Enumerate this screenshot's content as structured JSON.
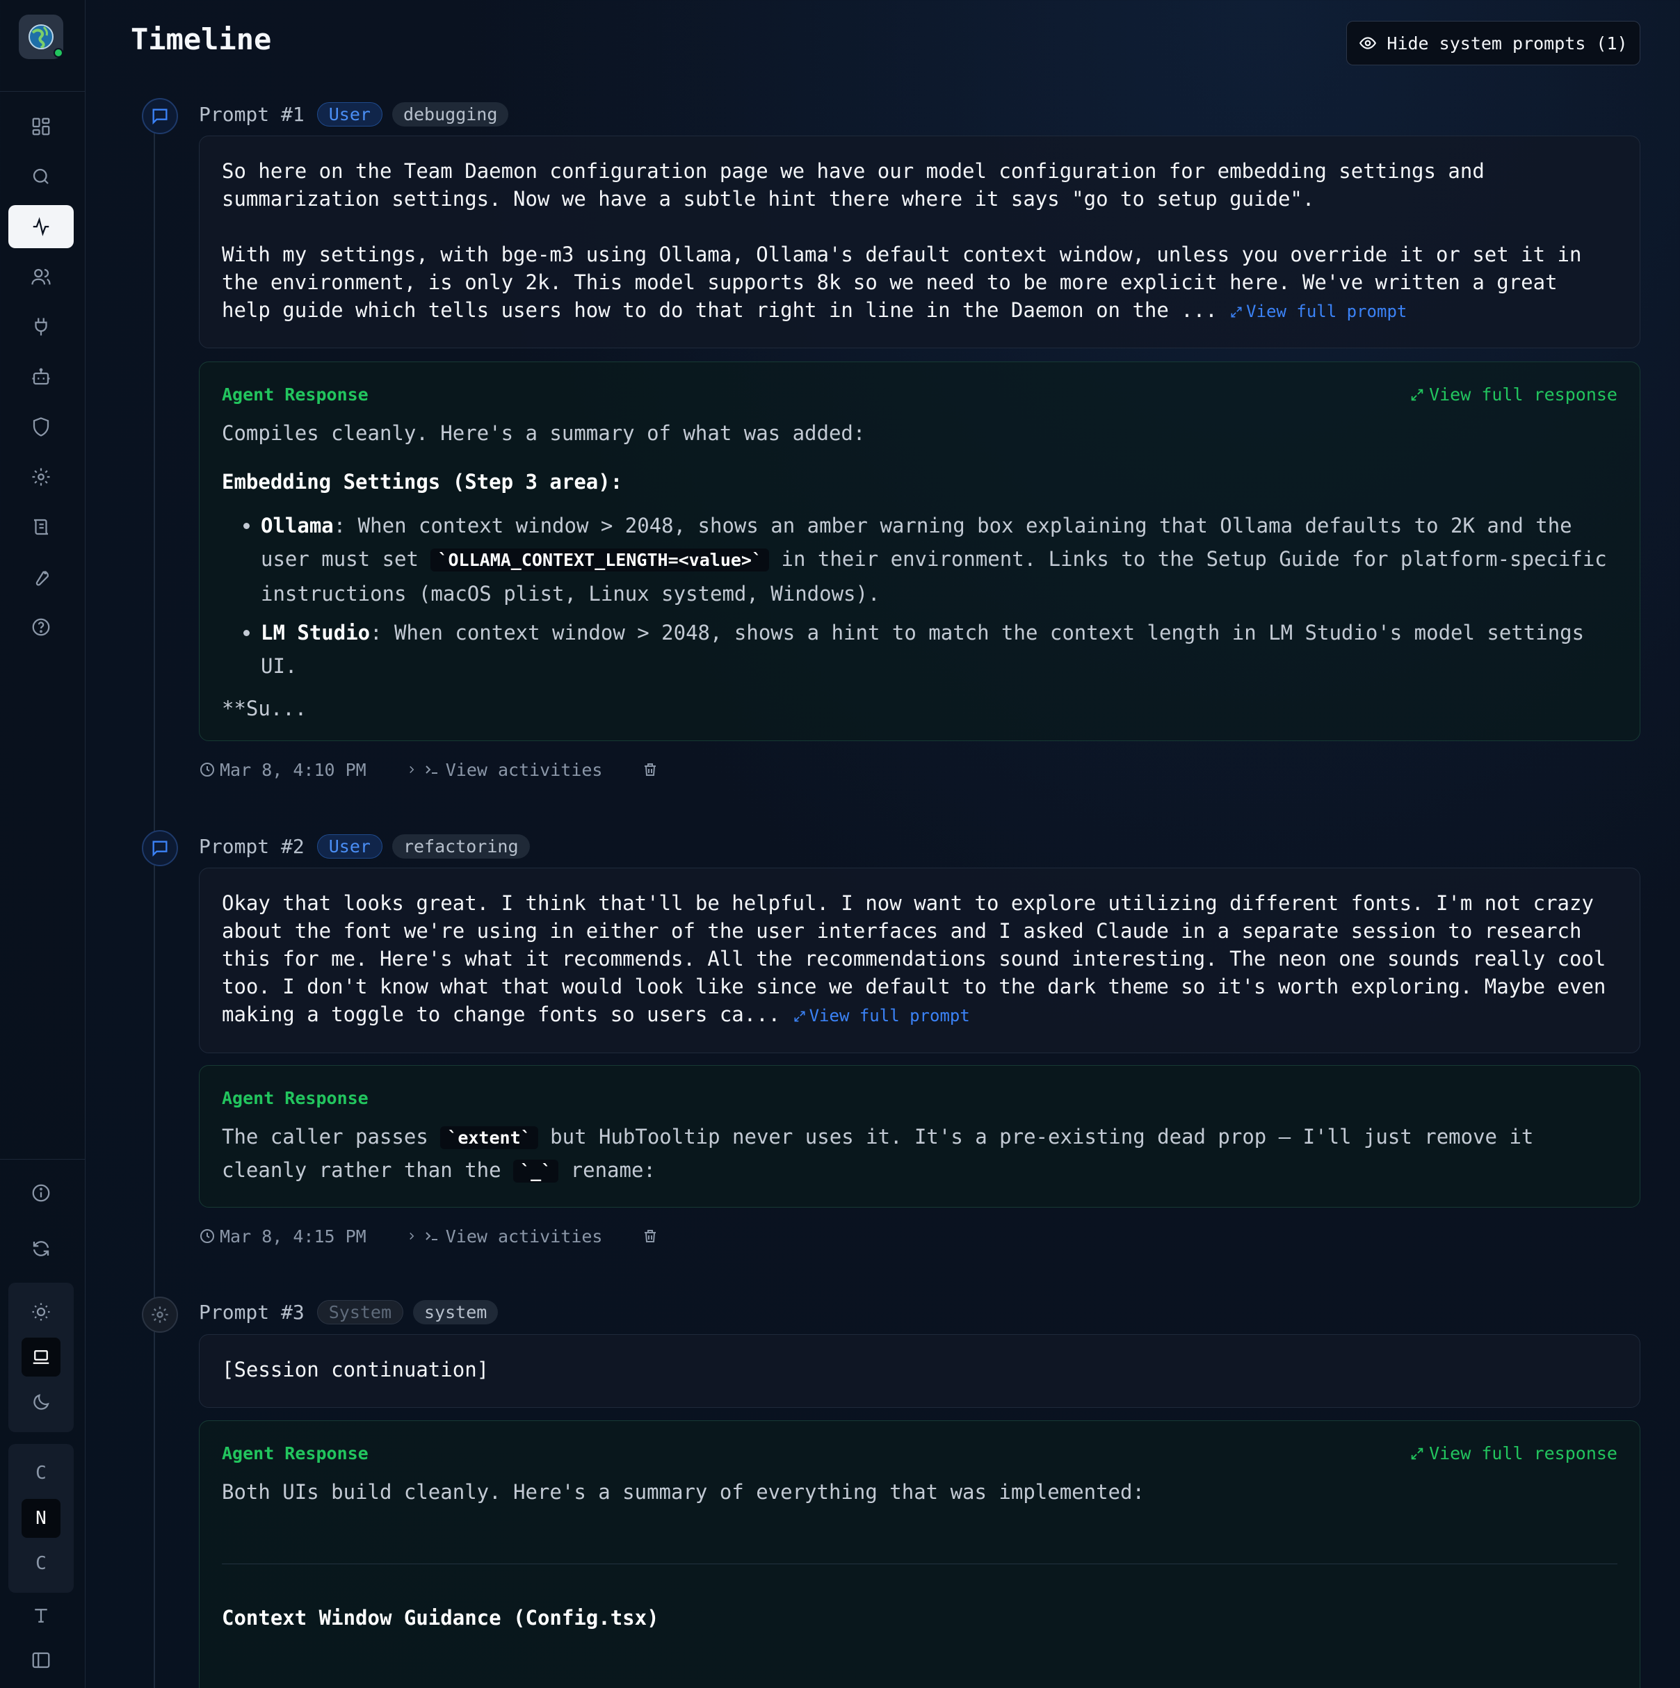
{
  "page": {
    "title": "Timeline",
    "hide_button_label": "Hide system prompts (1)"
  },
  "sidebar": {
    "nav_icons": [
      "dashboard-icon",
      "search-icon",
      "activity-icon",
      "users-icon",
      "plug-icon",
      "bot-icon",
      "shield-icon",
      "gear-icon",
      "logs-icon",
      "wrench-icon",
      "help-icon"
    ],
    "active": "activity-icon",
    "font_options": [
      "C",
      "N",
      "C"
    ]
  },
  "prompts": [
    {
      "number": "Prompt #1",
      "role": "User",
      "tag": "debugging",
      "text_p1": "So here on the Team Daemon configuration page we have our model configuration for embedding settings and summarization settings. Now we have a subtle hint there where it says \"go to setup guide\".",
      "text_p2": "With my settings, with bge-m3 using Ollama, Ollama's default context window, unless you override it or set it in the environment, is only 2k. This model supports 8k so we need to be more explicit here. We've written a great help guide which tells users how to do that right in line in the Daemon on the ...",
      "view_prompt": "View full prompt",
      "response": {
        "label": "Agent Response",
        "view_response": "View full response",
        "intro": "Compiles cleanly. Here's a summary of what was added:",
        "heading": "Embedding Settings (Step 3 area):",
        "item1_name": "Ollama",
        "item1_text_a": ": When context window > 2048, shows an amber warning box explaining that Ollama defaults to 2K and the user must set ",
        "item1_code": "`OLLAMA_CONTEXT_LENGTH=<value>`",
        "item1_text_b": " in their environment. Links to the Setup Guide for platform-specific instructions (macOS plist, Linux systemd, Windows).",
        "item2_name": "LM Studio",
        "item2_text": ": When context window > 2048, shows a hint to match the context length in LM Studio's model settings UI.",
        "trailing": "**Su..."
      },
      "time": "Mar 8, 4:10 PM",
      "activities": "View activities"
    },
    {
      "number": "Prompt #2",
      "role": "User",
      "tag": "refactoring",
      "text": "Okay that looks great. I think that'll be helpful. I now want to explore utilizing different fonts. I'm not crazy about the font we're using in either of the user interfaces and I asked Claude in a separate session to research this for me. Here's what it recommends. All the recommendations sound interesting. The neon one sounds really cool too. I don't know what that would look like since we default to the dark theme so it's worth exploring. Maybe even making a toggle to change fonts so users ca...",
      "view_prompt": "View full prompt",
      "response": {
        "label": "Agent Response",
        "text_a": "The caller passes ",
        "code_a": "`extent`",
        "text_b": " but HubTooltip never uses it. It's a pre-existing dead prop — I'll just remove it cleanly rather than the ",
        "code_b": "`_`",
        "text_c": " rename:"
      },
      "time": "Mar 8, 4:15 PM",
      "activities": "View activities"
    },
    {
      "number": "Prompt #3",
      "role": "System",
      "tag": "system",
      "text": "[Session continuation]",
      "response": {
        "label": "Agent Response",
        "view_response": "View full response",
        "intro": "Both UIs build cleanly. Here's a summary of everything that was implemented:",
        "heading": "Context Window Guidance (Config.tsx)"
      }
    }
  ]
}
